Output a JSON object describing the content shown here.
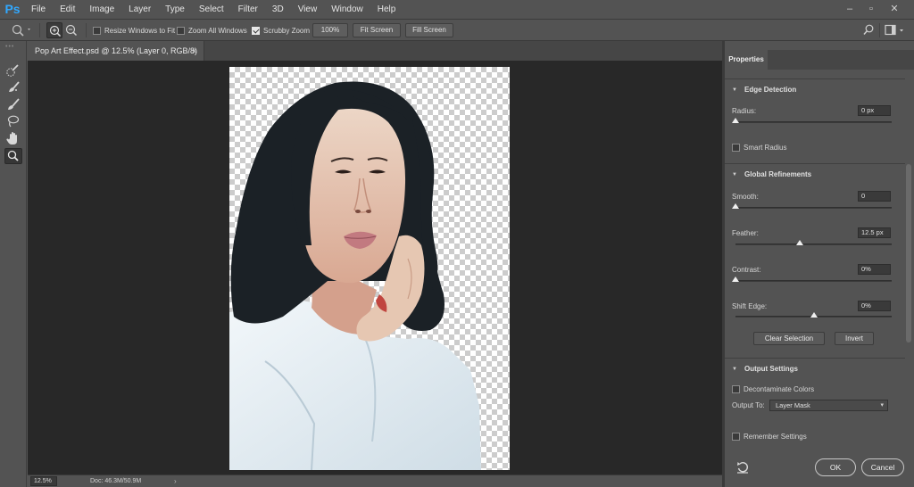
{
  "app": {
    "logo": "Ps"
  },
  "menu": [
    "File",
    "Edit",
    "Image",
    "Layer",
    "Type",
    "Select",
    "Filter",
    "3D",
    "View",
    "Window",
    "Help"
  ],
  "window_controls": {
    "minimize": "–",
    "restore": "▫",
    "close": "✕"
  },
  "options_bar": {
    "tool_icon": "zoom-icon",
    "resize_windows_to_fit": {
      "label": "Resize Windows to Fit",
      "checked": false
    },
    "zoom_all_windows": {
      "label": "Zoom All Windows",
      "checked": false
    },
    "scrubby_zoom": {
      "label": "Scrubby Zoom",
      "checked": true
    },
    "zoom_100_label": "100%",
    "fit_screen_label": "Fit Screen",
    "fill_screen_label": "Fill Screen"
  },
  "toolbar": {
    "grip": "•••",
    "tools": [
      {
        "name": "quick-selection-tool",
        "icon": "quick-selection-icon",
        "active": false
      },
      {
        "name": "refine-edge-brush-tool",
        "icon": "refine-edge-brush-icon",
        "active": false
      },
      {
        "name": "brush-tool",
        "icon": "brush-icon",
        "active": false
      },
      {
        "name": "lasso-tool",
        "icon": "lasso-icon",
        "active": false
      },
      {
        "name": "hand-tool",
        "icon": "hand-icon",
        "active": false
      },
      {
        "name": "zoom-tool",
        "icon": "zoom-icon",
        "active": true
      }
    ]
  },
  "document": {
    "tab_title": "Pop Art Effect.psd @ 12.5% (Layer 0, RGB/8)",
    "tab_close": "×",
    "status": {
      "zoom": "12.5%",
      "doc_info": "Doc: 46.3M/50.9M",
      "arrow": "›"
    }
  },
  "properties": {
    "tab_label": "Properties",
    "chevron": "▼",
    "edge_detection": {
      "title": "Edge Detection",
      "radius_label": "Radius:",
      "radius_value": "0 px",
      "radius_fraction": 0,
      "smart_radius_label": "Smart Radius"
    },
    "global_refinements": {
      "title": "Global Refinements",
      "smooth_label": "Smooth:",
      "smooth_value": "0",
      "smooth_fraction": 0,
      "feather_label": "Feather:",
      "feather_value": "12.5 px",
      "feather_fraction": 0.41,
      "contrast_label": "Contrast:",
      "contrast_value": "0%",
      "contrast_fraction": 0,
      "shift_edge_label": "Shift Edge:",
      "shift_edge_value": "0%",
      "shift_edge_fraction": 0.5,
      "clear_selection_label": "Clear Selection",
      "invert_label": "Invert"
    },
    "output_settings": {
      "title": "Output Settings",
      "decontaminate_label": "Decontaminate Colors",
      "output_to_label": "Output To:",
      "output_to_value": "Layer Mask",
      "caret": "▾"
    },
    "remember_settings_label": "Remember Settings",
    "ok_label": "OK",
    "cancel_label": "Cancel"
  },
  "colors": {
    "ui_bg": "#535353",
    "canvas_bg": "#282828",
    "ps_blue": "#31a8ff",
    "hair": "#1b2126",
    "shirt": "#e6eef2",
    "skin": "#e7c9b5"
  }
}
